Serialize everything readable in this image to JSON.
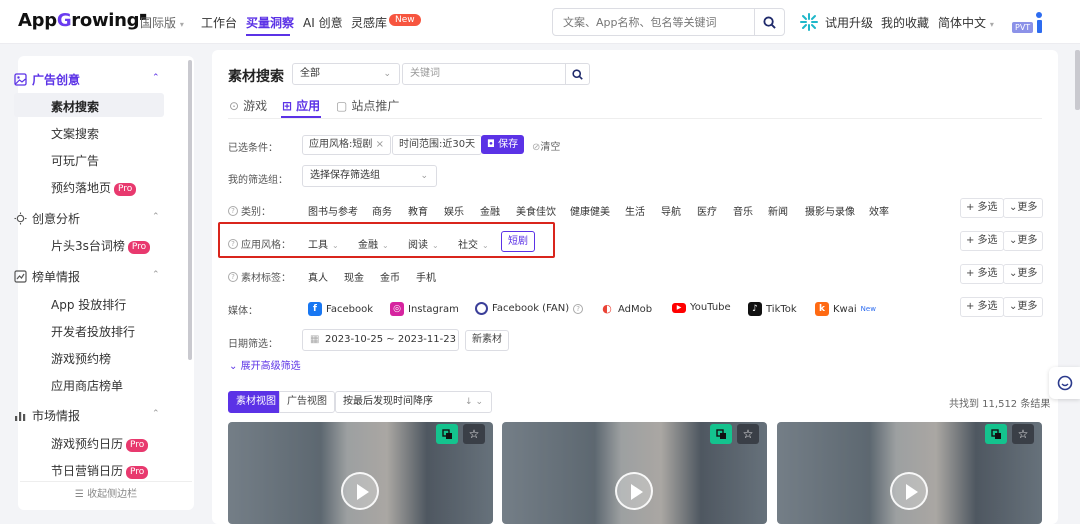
{
  "header": {
    "logo_prefix": "App",
    "logo_g": "G",
    "logo_suffix": "rowing",
    "region": "国际版",
    "nav": [
      "工作台",
      "买量洞察",
      "AI 创意",
      "灵感库"
    ],
    "new_badge": "New",
    "search_placeholder": "文案、App名称、包名等关键词",
    "upgrade": "试用升级",
    "favorites": "我的收藏",
    "language": "简体中文",
    "pvt": "PVT"
  },
  "sidebar": {
    "groups": [
      {
        "label": "广告创意",
        "icon": "image-icon"
      },
      {
        "label": "创意分析",
        "icon": "bulb-icon"
      },
      {
        "label": "榜单情报",
        "icon": "ranking-icon"
      },
      {
        "label": "市场情报",
        "icon": "chart-icon"
      }
    ],
    "items_creative": [
      "素材搜索",
      "文案搜索",
      "可玩广告",
      "预约落地页"
    ],
    "items_analysis": [
      "片头3s台词榜"
    ],
    "items_rank": [
      "App 投放排行",
      "开发者投放排行",
      "游戏预约榜",
      "应用商店榜单"
    ],
    "items_market": [
      "游戏预约日历",
      "节日营销日历"
    ],
    "pro": "Pro",
    "collapse": "收起侧边栏"
  },
  "main": {
    "title": "素材搜索",
    "scope_select": "全部",
    "keyword_placeholder": "关键词",
    "tabs": [
      "游戏",
      "应用",
      "站点推广"
    ],
    "selected_label": "已选条件：",
    "chip_style": "应用风格:短剧",
    "chip_time": "时间范围:近30天",
    "save": "保存",
    "clear": "清空",
    "my_filter_label": "我的筛选组：",
    "my_filter_select": "选择保存筛选组",
    "category_label": "类别：",
    "categories": [
      "图书与参考",
      "商务",
      "教育",
      "娱乐",
      "金融",
      "美食佳饮",
      "健康健美",
      "生活",
      "导航",
      "医疗",
      "音乐",
      "新闻",
      "摄影与录像",
      "效率"
    ],
    "multi": "+ 多选",
    "more": "更多",
    "style_label": "应用风格：",
    "styles": [
      "工具",
      "金融",
      "阅读",
      "社交"
    ],
    "style_selected": "短剧",
    "tag_label": "素材标签：",
    "tags": [
      "真人",
      "现金",
      "金币",
      "手机"
    ],
    "media_label": "媒体：",
    "media": [
      "Facebook",
      "Instagram",
      "Facebook (FAN)",
      "AdMob",
      "YouTube",
      "TikTok",
      "Kwai"
    ],
    "kwai_new": "New",
    "date_label": "日期筛选：",
    "date_range": "2023-10-25 ~ 2023-11-23",
    "new_material": "新素材",
    "advanced": "展开高级筛选",
    "view_material": "素材视图",
    "view_ad": "广告视图",
    "sort": "按最后发现时间降序",
    "count": "共找到 11,512 条结果"
  },
  "colors": {
    "accent": "#5b32e6",
    "pro": "#e8396e",
    "red_box": "#d9251c",
    "green": "#14c38e"
  }
}
